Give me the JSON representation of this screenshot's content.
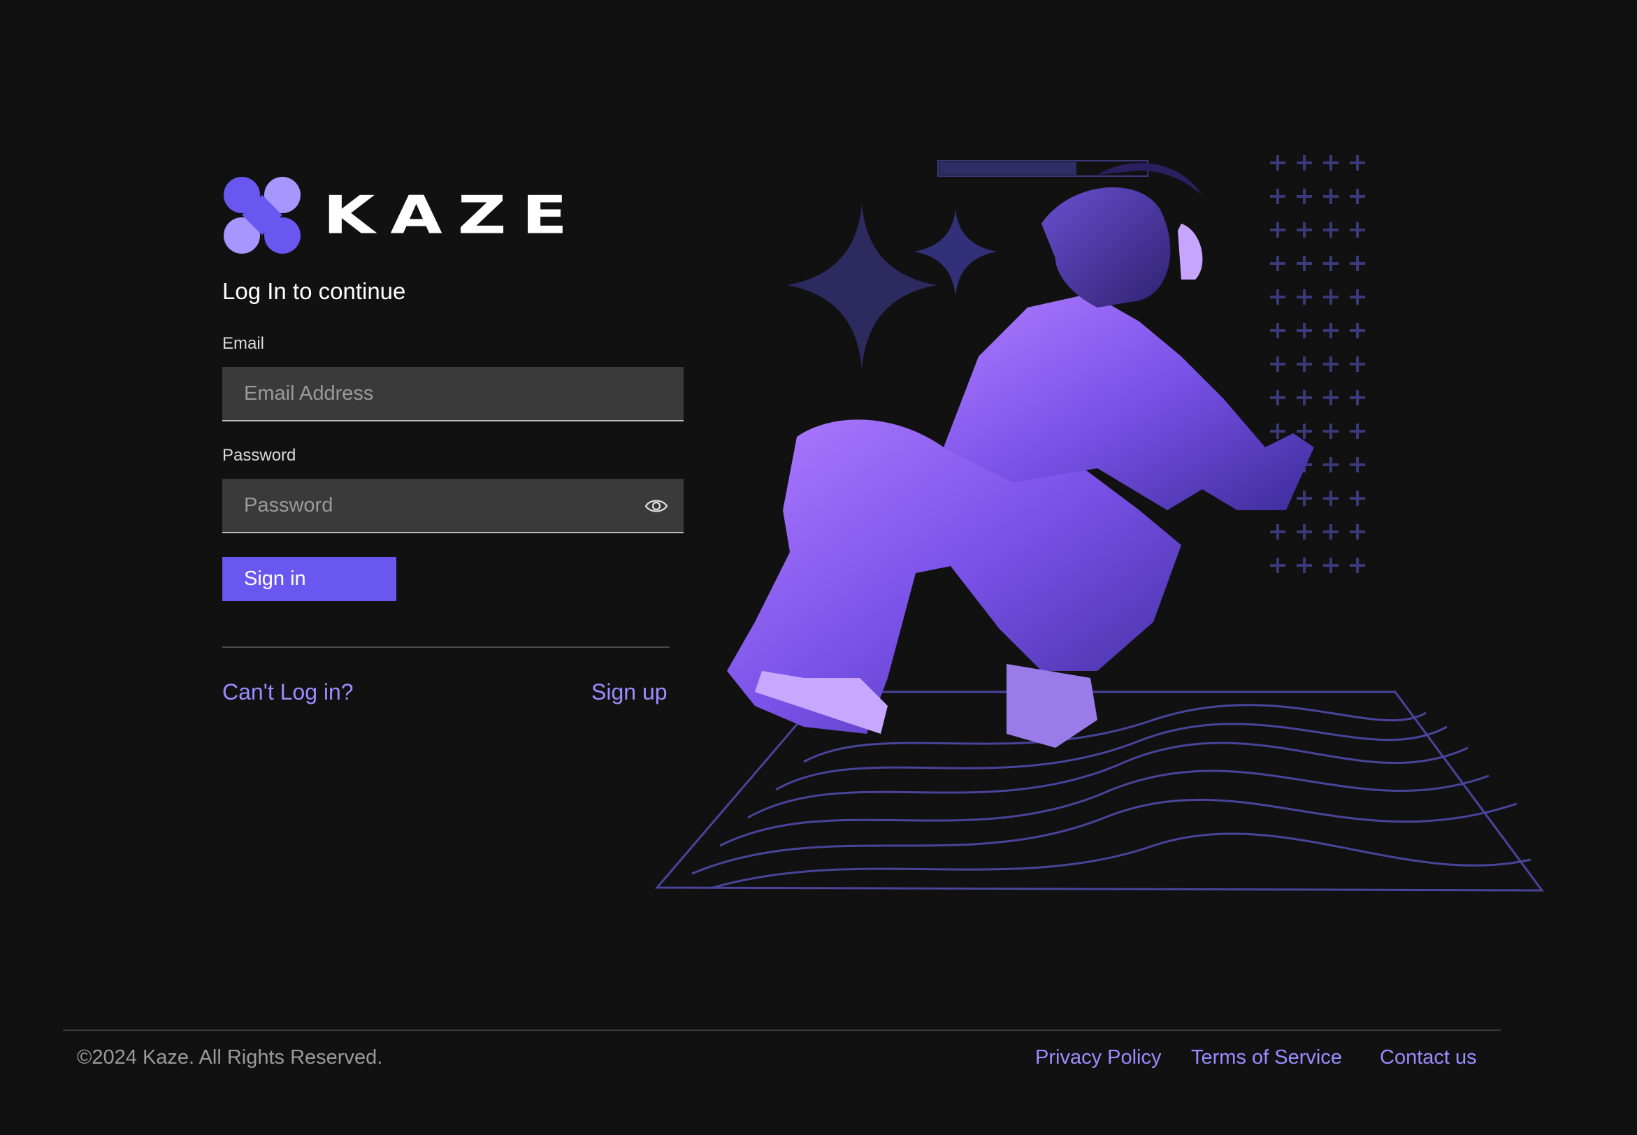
{
  "brand": {
    "name": "KAZE",
    "accent": "#6a57f0",
    "link_color": "#9d8cff"
  },
  "form": {
    "heading": "Log In to continue",
    "email_label": "Email",
    "email_placeholder": "Email Address",
    "password_label": "Password",
    "password_placeholder": "Password",
    "signin_label": "Sign in",
    "cant_login": "Can't Log in?",
    "signup": "Sign up"
  },
  "icons": {
    "logo": "kaze-logo-icon",
    "eye": "eye-icon"
  },
  "footer": {
    "copyright": "©2024 Kaze. All Rights Reserved.",
    "privacy": "Privacy Policy",
    "terms": "Terms of Service",
    "contact": "Contact us"
  }
}
